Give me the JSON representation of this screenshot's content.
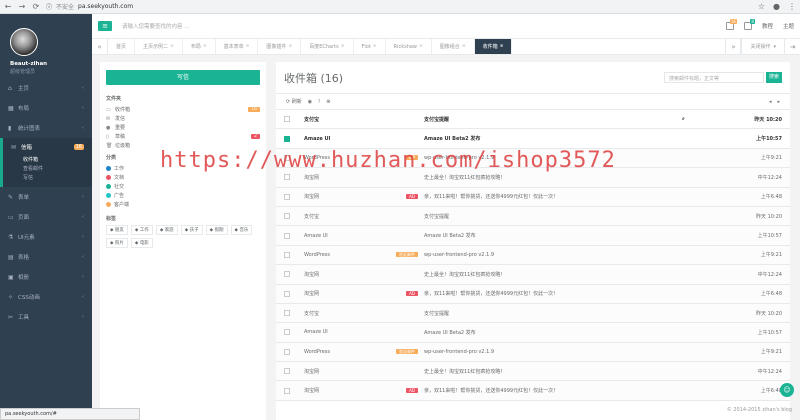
{
  "browser": {
    "insecure": "不安全",
    "url": "pa.seekyouth.com"
  },
  "profile": {
    "name": "Beaut-zihan",
    "role": "超级管理员"
  },
  "sidebar": {
    "items": [
      {
        "label": "主页",
        "icon": "home-icon"
      },
      {
        "label": "布局",
        "icon": "layout-icon"
      },
      {
        "label": "统计图表",
        "icon": "chart-icon"
      },
      {
        "label": "信箱",
        "icon": "envelope-icon",
        "badge": "16"
      },
      {
        "label": "表单",
        "icon": "edit-icon"
      },
      {
        "label": "页面",
        "icon": "desktop-icon"
      },
      {
        "label": "UI元素",
        "icon": "flask-icon"
      },
      {
        "label": "表格",
        "icon": "table-icon"
      },
      {
        "label": "相册",
        "icon": "picture-icon"
      },
      {
        "label": "CSS动画",
        "icon": "magic-icon"
      },
      {
        "label": "工具",
        "icon": "cutlery-icon"
      }
    ],
    "submenu": [
      "收件箱",
      "查看邮件",
      "写信"
    ]
  },
  "topbar": {
    "search_placeholder": "请输入您需要查找的内容 ...",
    "msg_count": "16",
    "notif_count": "8",
    "theme1": "教程",
    "theme2": "主题"
  },
  "tabs": [
    {
      "label": "首页",
      "closable": false
    },
    {
      "label": "主页示例二"
    },
    {
      "label": "布局"
    },
    {
      "label": "基本表单"
    },
    {
      "label": "图像插件"
    },
    {
      "label": "百度ECharts"
    },
    {
      "label": "Flot"
    },
    {
      "label": "Rickshaw"
    },
    {
      "label": "图像组合"
    },
    {
      "label": "收件箱"
    }
  ],
  "tab_actions": "关闭操作",
  "leftpanel": {
    "compose": "写信",
    "folders_title": "文件夹",
    "folders": [
      {
        "label": "收件箱",
        "count": "16",
        "color": "#f8ac59",
        "icon": "inbox-icon"
      },
      {
        "label": "发信",
        "icon": "envelope-icon"
      },
      {
        "label": "重要",
        "icon": "certificate-icon"
      },
      {
        "label": "草稿",
        "count": "2",
        "color": "#ed5565",
        "icon": "file-icon"
      },
      {
        "label": "垃圾箱",
        "icon": "trash-icon"
      }
    ],
    "cats_title": "分类",
    "cats": [
      {
        "label": "工作",
        "color": "#1c84c6"
      },
      {
        "label": "文档",
        "color": "#ed5565"
      },
      {
        "label": "社交",
        "color": "#1ab394"
      },
      {
        "label": "广告",
        "color": "#23c6c8"
      },
      {
        "label": "客户端",
        "color": "#f8ac59"
      }
    ],
    "tags_title": "标签",
    "tags": [
      "朋友",
      "工作",
      "家庭",
      "孩子",
      "假期",
      "音乐",
      "照片",
      "电影"
    ]
  },
  "mailbox": {
    "title": "收件箱 (16)",
    "search_placeholder": "搜索邮件标题，正文等",
    "search_btn": "搜索",
    "refresh": "刷新"
  },
  "rows": [
    {
      "from": "支付宝",
      "subject": "支付宝提醒",
      "time": "昨天 10:20",
      "unread": true,
      "attach": true
    },
    {
      "from": "Amaze UI",
      "subject": "Amaze UI Beta2 发布",
      "time": "上午10:57",
      "unread": true,
      "checked": true
    },
    {
      "from": "WordPress",
      "badge": "VIP",
      "badge_color": "#f8ac59",
      "subject": "wp-user-frontend-pro v2.1.9",
      "time": "上午9:21",
      "unread": false
    },
    {
      "from": "淘宝网",
      "subject": "史上最全！淘宝双11红包疯抢攻略！",
      "time": "中午12:24",
      "unread": false
    },
    {
      "from": "淘宝网",
      "badge": "AD",
      "badge_color": "#ed5565",
      "subject": "亲，双11来啦！帮你挑货，还送你4999元红包！仅此一次！",
      "time": "上午6:48",
      "unread": false
    },
    {
      "from": "支付宝",
      "subject": "支付宝提醒",
      "time": "昨天 10:20",
      "unread": false
    },
    {
      "from": "Amaze UI",
      "subject": "Amaze UI Beta2 发布",
      "time": "上午10:57",
      "unread": false
    },
    {
      "from": "WordPress",
      "badge": "验证邮件",
      "badge_color": "#f8ac59",
      "subject": "wp-user-frontend-pro v2.1.9",
      "time": "上午9:21",
      "unread": false
    },
    {
      "from": "淘宝网",
      "subject": "史上最全！淘宝双11红包疯抢攻略！",
      "time": "中午12:24",
      "unread": false
    },
    {
      "from": "淘宝网",
      "badge": "AD",
      "badge_color": "#ed5565",
      "subject": "亲，双11来啦！帮你挑货，还送你4999元红包！仅此一次！",
      "time": "上午6:48",
      "unread": false
    },
    {
      "from": "支付宝",
      "subject": "支付宝提醒",
      "time": "昨天 10:20",
      "unread": false
    },
    {
      "from": "Amaze UI",
      "subject": "Amaze UI Beta2 发布",
      "time": "上午10:57",
      "unread": false
    },
    {
      "from": "WordPress",
      "badge": "验证邮件",
      "badge_color": "#f8ac59",
      "subject": "wp-user-frontend-pro v2.1.9",
      "time": "上午9:21",
      "unread": false
    },
    {
      "from": "淘宝网",
      "subject": "史上最全！淘宝双11红包疯抢攻略！",
      "time": "中午12:24",
      "unread": false
    },
    {
      "from": "淘宝网",
      "badge": "AD",
      "badge_color": "#ed5565",
      "subject": "亲，双11来啦！帮你挑货，还送你4999元红包！仅此一次！",
      "time": "上午6:48",
      "unread": false
    }
  ],
  "statusbar": "pa.seekyouth.com/#",
  "footer": "© 2014-2015 zihan's blog",
  "watermark": "https://www.huzhan.com/ishop3572"
}
